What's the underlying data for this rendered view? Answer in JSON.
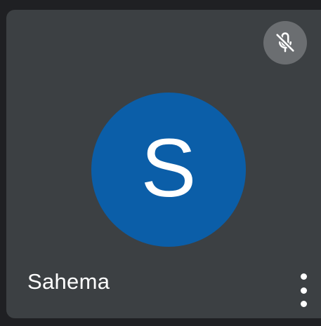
{
  "participant": {
    "name": "Sahema",
    "initial": "S",
    "avatar_color": "#0b5ea8",
    "muted": true
  },
  "icons": {
    "mute": "mic-off-icon",
    "more": "more-vert-icon"
  },
  "colors": {
    "tile_background": "#3c4043",
    "page_background": "#1f2023",
    "mute_badge": "#6b6e71"
  }
}
